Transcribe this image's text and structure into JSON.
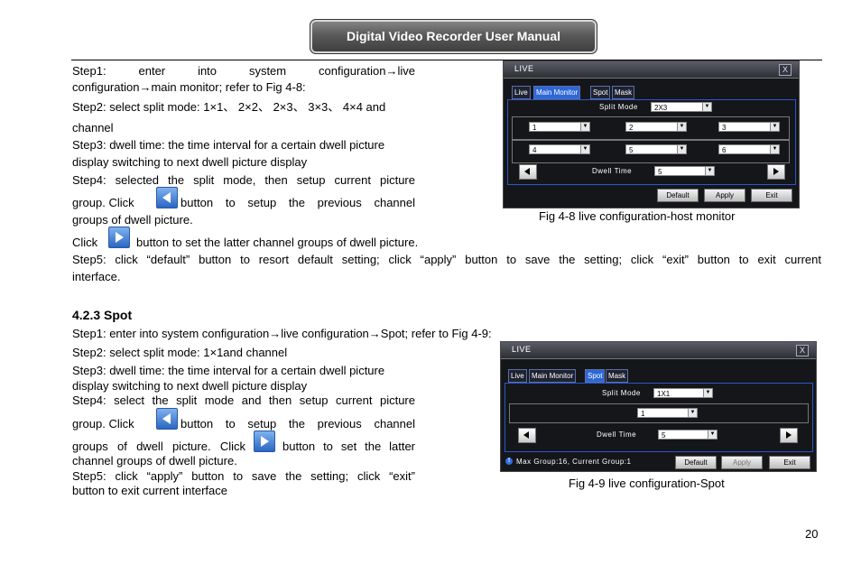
{
  "header": {
    "title": "Digital Video Recorder User Manual"
  },
  "section1": {
    "step1_a": "Step1:   enter   into   system   configuration→live",
    "step1_b": "configuration→main monitor; refer to Fig 4-8:",
    "step2_a": "Step2: select split mode: 1×1、 2×2、 2×3、 3×3、 4×4 and",
    "step2_b": "channel",
    "step3_a": "Step3: dwell time: the time interval for a certain dwell picture",
    "step3_b": "display switching to next dwell picture display",
    "step4_a": "Step4: selected the split mode, then setup current picture",
    "step4_b1": "group.  Click",
    "step4_b2": "button  to  setup  the  previous  channel",
    "step4_c": "groups of dwell picture.",
    "click_a": "Click",
    "click_b": "button to set the latter channel groups of dwell picture.",
    "step5_a": "Step5: click “default” button to resort default setting; click “apply” button to save the setting; click “exit” button to exit current",
    "step5_b": "interface."
  },
  "section2": {
    "heading": "4.2.3  Spot",
    "step1": "Step1: enter into system configuration→live configuration→Spot; refer to Fig 4-9:",
    "step2": "Step2: select split mode: 1×1and channel",
    "step3_a": "Step3: dwell time: the time interval for a certain dwell picture",
    "step3_b": "display switching to next dwell picture display",
    "step4_a": "Step4: select the split mode and then setup current picture",
    "step4_b1": "group.  Click",
    "step4_b2": "button  to  setup  the  previous  channel",
    "step4_c1": "groups  of  dwell  picture.  Click",
    "step4_c2": "button  to  set  the  latter",
    "step4_d": "channel groups of dwell picture.",
    "step5_a": "Step5:  click  “apply”  button  to  save  the  setting;  click  “exit”",
    "step5_b": "button to exit current interface"
  },
  "fig1": {
    "title": "LIVE",
    "close": "X",
    "tabs": [
      "Live",
      "Main Monitor",
      "Spot",
      "Mask"
    ],
    "active_tab": "Main Monitor",
    "split_mode_label": "Split Mode",
    "split_mode_value": "2X3",
    "channels": [
      "1",
      "2",
      "3",
      "4",
      "5",
      "6"
    ],
    "dwell_time_label": "Dwell Time",
    "dwell_time_value": "5",
    "buttons": [
      "Default",
      "Apply",
      "Exit"
    ],
    "caption": "Fig 4-8 live configuration-host monitor"
  },
  "fig2": {
    "title": "LIVE",
    "close": "X",
    "tabs": [
      "Live",
      "Main Monitor",
      "Spot",
      "Mask"
    ],
    "active_tab": "Spot",
    "split_mode_label": "Split Mode",
    "split_mode_value": "1X1",
    "channel_value": "1",
    "dwell_time_label": "Dwell Time",
    "dwell_time_value": "5",
    "info": "Max Group:16,  Current Group:1",
    "info_icon": "!",
    "buttons": [
      "Default",
      "Apply",
      "Exit"
    ],
    "caption": "Fig 4-9 live configuration-Spot"
  },
  "page_number": "20",
  "icons": {
    "prev": "arrow-left-icon",
    "next": "arrow-right-icon",
    "accent": "#2a66c4"
  }
}
